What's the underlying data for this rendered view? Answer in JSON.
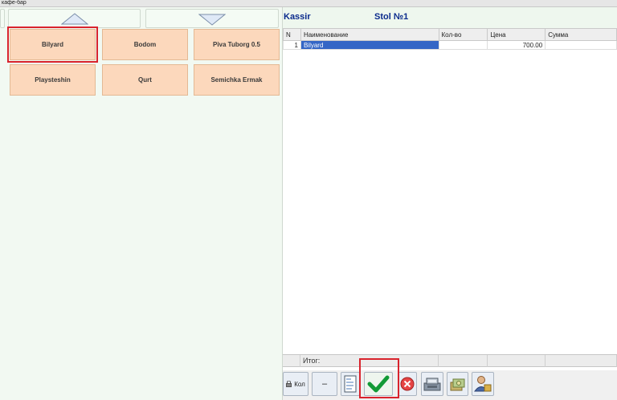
{
  "window": {
    "title": "кафе-бар"
  },
  "nav": {
    "up_icon": "arrow-up-icon",
    "down_icon": "arrow-down-icon"
  },
  "products": [
    {
      "label": "Bilyard",
      "selected": true
    },
    {
      "label": "Bodom"
    },
    {
      "label": "Piva Tuborg 0.5"
    },
    {
      "label": "Playsteshin"
    },
    {
      "label": "Qurt"
    },
    {
      "label": "Semichka Ermak"
    }
  ],
  "header": {
    "cashier": "Kassir",
    "table": "Stol №1"
  },
  "order_table": {
    "columns": [
      "N",
      "Наименование",
      "Кол-во",
      "Цена",
      "Сумма"
    ],
    "rows": [
      {
        "n": "1",
        "name": "Bilyard",
        "qty": "",
        "price": "700.00",
        "sum": ""
      }
    ]
  },
  "total": {
    "label": "Итог:"
  },
  "toolbar": {
    "qty_label": "Кол",
    "minus_label": "–",
    "icons": [
      "print-icon",
      "confirm-check-icon",
      "cancel-icon",
      "cash-register-icon",
      "money-icon",
      "users-icon"
    ]
  },
  "colors": {
    "product_bg": "#fcd8bc",
    "highlight": "#3466c6",
    "header_text": "#0a2a8c",
    "selection_outline": "#d9232d"
  }
}
